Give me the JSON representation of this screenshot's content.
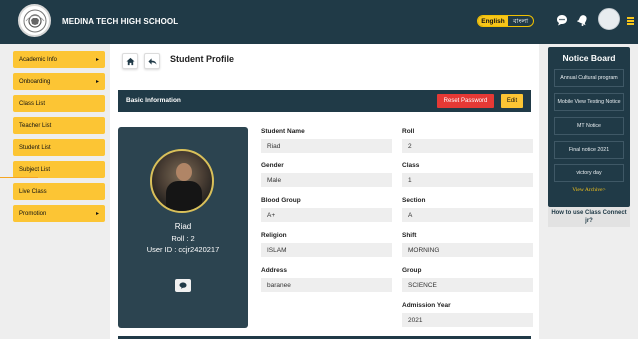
{
  "header": {
    "school_name": "MEDINA TECH HIGH SCHOOL",
    "lang_english": "English",
    "lang_bangla": "বাংলা"
  },
  "sidebar": {
    "items": [
      {
        "label": "Academic Info",
        "caret": "▸"
      },
      {
        "label": "Onboarding",
        "caret": "▸"
      },
      {
        "label": "Class List",
        "caret": ""
      },
      {
        "label": "Teacher List",
        "caret": ""
      },
      {
        "label": "Student List",
        "caret": ""
      },
      {
        "label": "Subject List",
        "caret": ""
      },
      {
        "label": "Live Class",
        "caret": ""
      },
      {
        "label": "Promotion",
        "caret": "▸"
      }
    ]
  },
  "page": {
    "title": "Student Profile",
    "section_title": "Basic Information",
    "reset_password": "Reset Password",
    "edit": "Edit"
  },
  "profile": {
    "name": "Riad",
    "roll_line": "Roll : 2",
    "userid_line": "User ID : ccjr2420217"
  },
  "fields": {
    "student_name": {
      "label": "Student Name",
      "value": "Riad"
    },
    "roll": {
      "label": "Roll",
      "value": "2"
    },
    "gender": {
      "label": "Gender",
      "value": "Male"
    },
    "class": {
      "label": "Class",
      "value": "1"
    },
    "blood_group": {
      "label": "Blood Group",
      "value": "A+"
    },
    "section": {
      "label": "Section",
      "value": "A"
    },
    "religion": {
      "label": "Religion",
      "value": "ISLAM"
    },
    "shift": {
      "label": "Shift",
      "value": "MORNING"
    },
    "address": {
      "label": "Address",
      "value": "baranee"
    },
    "group": {
      "label": "Group",
      "value": "SCIENCE"
    },
    "admission_year": {
      "label": "Admission Year",
      "value": "2021"
    }
  },
  "notice_board": {
    "title": "Notice Board",
    "items": [
      "Annual Cultural program",
      "Mobile View Testing Notice",
      "MT Notice",
      "Final notice 2021",
      "victory day"
    ],
    "archive": "View Archive>",
    "how_to": "How to use Class Connect jr?"
  },
  "icons": {
    "home": "home-icon",
    "back": "back-arrow-icon",
    "chat": "chat-icon",
    "notification": "bell-icon",
    "menu": "hamburger-icon"
  },
  "colors": {
    "navy": "#203a47",
    "accent": "#fcc534",
    "danger": "#e53935"
  }
}
